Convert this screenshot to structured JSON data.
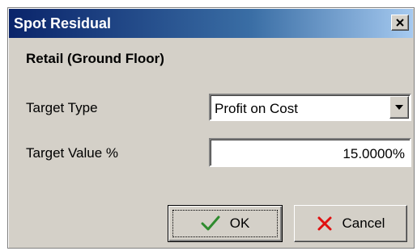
{
  "window": {
    "title": "Spot Residual",
    "close_icon": "close-icon"
  },
  "section": {
    "heading": "Retail (Ground Floor)"
  },
  "fields": {
    "target_type": {
      "label": "Target Type",
      "value": "Profit on Cost"
    },
    "target_value": {
      "label": "Target Value %",
      "value": "15.0000%"
    }
  },
  "buttons": {
    "ok": {
      "label": "OK",
      "icon": "checkmark-icon",
      "icon_color": "#2e8b2e"
    },
    "cancel": {
      "label": "Cancel",
      "icon": "x-icon",
      "icon_color": "#e01010"
    }
  },
  "colors": {
    "title_gradient_start": "#0a246a",
    "title_gradient_end": "#a6caf0",
    "dialog_bg": "#d4d0c8"
  }
}
